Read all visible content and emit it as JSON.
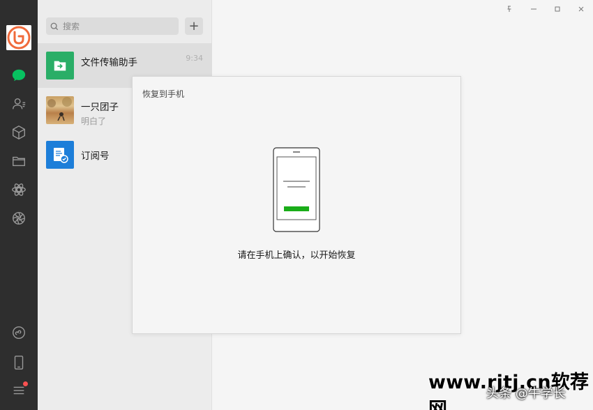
{
  "search": {
    "placeholder": "搜索"
  },
  "chats": [
    {
      "name": "文件传输助手",
      "time": "9:34",
      "preview": ""
    },
    {
      "name": "一只团子",
      "time": "",
      "preview": "明白了"
    },
    {
      "name": "订阅号",
      "time": "",
      "preview": ""
    }
  ],
  "dialog": {
    "title": "恢复到手机",
    "message": "请在手机上确认，以开始恢复"
  },
  "watermark": {
    "site": "www.rjtj.cn软荐网",
    "source": "头条 @牛学长"
  },
  "colors": {
    "sidebar_bg": "#2e2e2e",
    "accent_green": "#07c160",
    "file_helper_green": "#2aae67",
    "subscription_blue": "#1d7ed9",
    "avatar_orange": "#f06a3b",
    "notify_red": "#fa5151"
  },
  "icons": {
    "sidebar": [
      "chat-icon",
      "contacts-icon",
      "favorites-cube-icon",
      "folder-icon",
      "moments-icon",
      "channels-icon",
      "mini-program-icon",
      "phone-icon",
      "menu-icon"
    ],
    "window": [
      "pin-icon",
      "minimize-icon",
      "maximize-icon",
      "close-icon"
    ]
  }
}
